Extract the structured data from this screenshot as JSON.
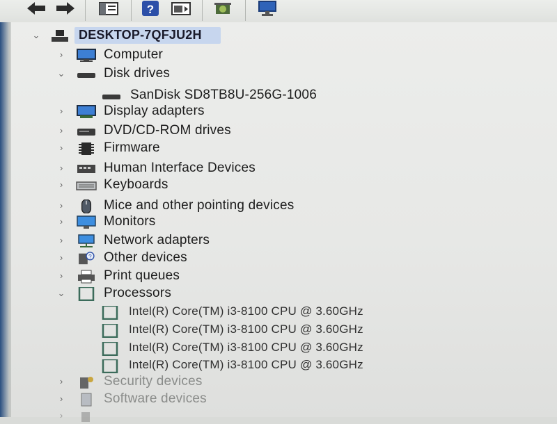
{
  "toolbar": {
    "buttons": [
      {
        "name": "back-arrow-icon"
      },
      {
        "name": "forward-arrow-icon"
      },
      {
        "name": "show-hide-console-tree-icon"
      },
      {
        "name": "help-icon"
      },
      {
        "name": "action-pane-icon"
      },
      {
        "name": "update-driver-icon"
      },
      {
        "name": "scan-hardware-icon"
      }
    ]
  },
  "tree": {
    "root": {
      "label": "DESKTOP-7QFJU2H",
      "expanded": true
    },
    "categories": [
      {
        "label": "Computer",
        "expanded": false
      },
      {
        "label": "Disk drives",
        "expanded": true,
        "children": [
          "SanDisk SD8TB8U-256G-1006"
        ]
      },
      {
        "label": "Display adapters",
        "expanded": false
      },
      {
        "label": "DVD/CD-ROM drives",
        "expanded": false
      },
      {
        "label": "Firmware",
        "expanded": false
      },
      {
        "label": "Human Interface Devices",
        "expanded": false
      },
      {
        "label": "Keyboards",
        "expanded": false
      },
      {
        "label": "Mice and other pointing devices",
        "expanded": false
      },
      {
        "label": "Monitors",
        "expanded": false
      },
      {
        "label": "Network adapters",
        "expanded": false
      },
      {
        "label": "Other devices",
        "expanded": false
      },
      {
        "label": "Print queues",
        "expanded": false
      },
      {
        "label": "Processors",
        "expanded": true,
        "children": [
          "Intel(R) Core(TM) i3-8100 CPU @ 3.60GHz",
          "Intel(R) Core(TM) i3-8100 CPU @ 3.60GHz",
          "Intel(R) Core(TM) i3-8100 CPU @ 3.60GHz",
          "Intel(R) Core(TM) i3-8100 CPU @ 3.60GHz"
        ]
      },
      {
        "label": "Security devices",
        "expanded": false
      },
      {
        "label": "Software devices",
        "expanded": false
      }
    ]
  },
  "colors": {
    "selection": "#c7d6ee",
    "accent": "#2a5fa8"
  }
}
